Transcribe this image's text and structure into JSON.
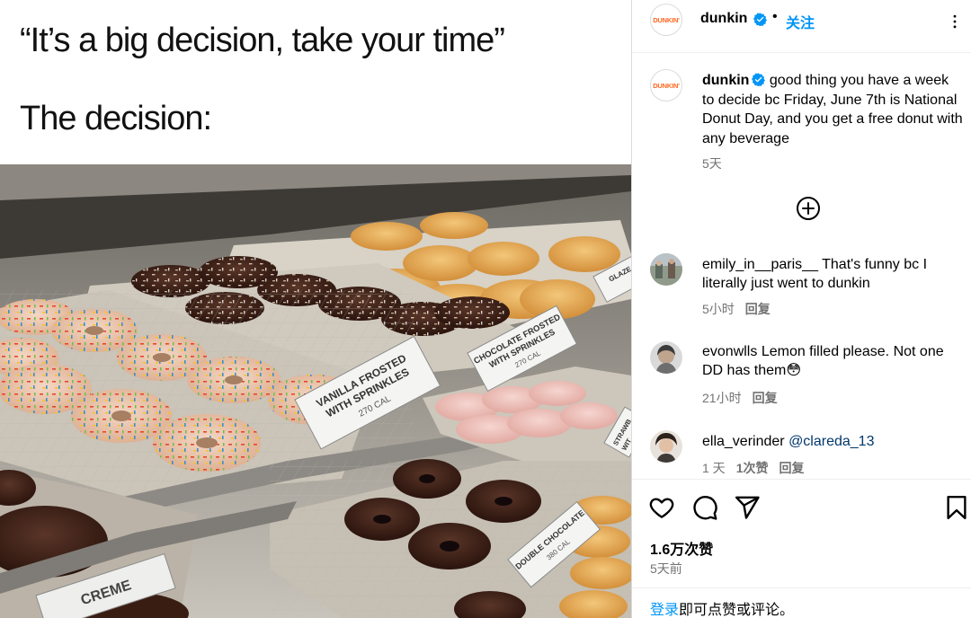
{
  "meme": {
    "line1": "“It’s a big decision, take your time”",
    "line2": "The decision:"
  },
  "photo": {
    "tags": [
      "VANILLA FROSTED",
      "WITH SPRINKLES",
      "270 CAL",
      "CHOCOLATE FROSTED",
      "WITH SPRINKLES",
      "270 CAL",
      "DOUBLE CHOCOLATE",
      "380 CAL",
      "GLAZE",
      "STRAWB",
      "WIT",
      "CREME"
    ]
  },
  "header": {
    "logo_text": "DUNKIN'",
    "username": "dunkin",
    "separator": "•",
    "follow_label": "关注"
  },
  "caption": {
    "username": "dunkin",
    "text": "good thing you have a week to decide bc Friday, June 7th is National Donut Day, and you get a free donut with any beverage",
    "time": "5天"
  },
  "comments": [
    {
      "username": "emily_in__paris__",
      "text": "That's funny bc I literally just went to dunkin",
      "time": "5小时",
      "reply_label": "回复"
    },
    {
      "username": "evonwlls",
      "text": "Lemon filled please. Not one DD has them",
      "emoji": "😳",
      "time": "21小时",
      "reply_label": "回复"
    },
    {
      "username": "ella_verinder",
      "mention": "@clareda_13",
      "time": "1 天",
      "likes_label": "1次赞",
      "reply_label": "回复"
    }
  ],
  "actions": {
    "likes": "1.6万次赞",
    "posted": "5天前",
    "login_link": "登录",
    "login_text": "即可点赞或评论。"
  },
  "colors": {
    "accent": "#0095f6",
    "brand_orange": "#ff671f",
    "secondary_text": "#737373"
  },
  "icons": [
    "verified-badge-icon",
    "more-options-icon",
    "load-more-plus-icon",
    "heart-icon",
    "comment-icon",
    "share-icon",
    "bookmark-icon"
  ]
}
